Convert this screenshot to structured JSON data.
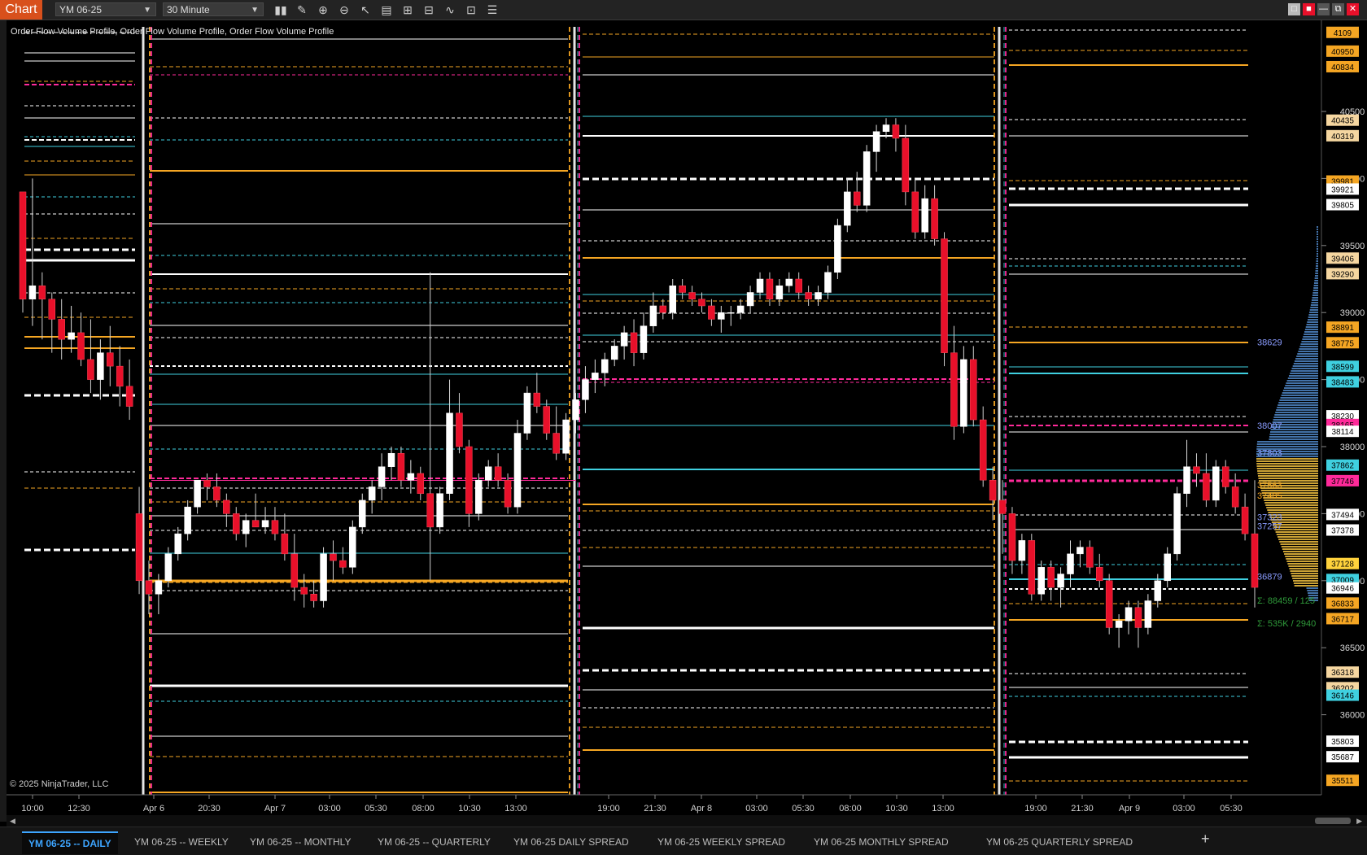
{
  "toolbar": {
    "chart_tab": "Chart",
    "instrument": "YM 06-25",
    "interval": "30 Minute",
    "tools": [
      {
        "icon": "bar-style-icon",
        "glyph": "▮▮"
      },
      {
        "icon": "draw-pencil-icon",
        "glyph": "✎"
      },
      {
        "icon": "zoom-in-icon",
        "glyph": "⊕"
      },
      {
        "icon": "zoom-out-icon",
        "glyph": "⊖"
      },
      {
        "icon": "pointer-icon",
        "glyph": "↖"
      },
      {
        "icon": "properties-icon",
        "glyph": "▤"
      },
      {
        "icon": "templates-icon",
        "glyph": "⊞"
      },
      {
        "icon": "strategies-icon",
        "glyph": "⊟"
      },
      {
        "icon": "indicators-icon",
        "glyph": "∿"
      },
      {
        "icon": "data-box-icon",
        "glyph": "⊡"
      },
      {
        "icon": "list-icon",
        "glyph": "☰"
      }
    ],
    "window_buttons": [
      "□",
      "■",
      "—",
      "⧉",
      "✕"
    ]
  },
  "chart": {
    "indicator_title": "Order Flow Volume Profile, Order Flow Volume Profile, Order Flow Volume Profile",
    "copyright": "© 2025 NinjaTrader, LLC",
    "colors": {
      "background": "#000000",
      "up": "#ffffff",
      "down": "#e8102a",
      "orange": "#f5a623",
      "cyan": "#3fd0e0",
      "magenta": "#ff2a9a"
    }
  },
  "chart_data": {
    "type": "candlestick",
    "instrument": "YM 06-25",
    "interval": "30 Minute",
    "y_ticks": [
      40500,
      40000,
      39500,
      39000,
      38500,
      38000,
      37500,
      37000,
      36500,
      36000
    ],
    "x_ticks": [
      {
        "label": "10:00",
        "x": 40
      },
      {
        "label": "12:30",
        "x": 97
      },
      {
        "label": "Apr 6",
        "x": 189
      },
      {
        "label": "20:30",
        "x": 257
      },
      {
        "label": "Apr 7",
        "x": 338
      },
      {
        "label": "03:00",
        "x": 405
      },
      {
        "label": "05:30",
        "x": 462
      },
      {
        "label": "08:00",
        "x": 520
      },
      {
        "label": "10:30",
        "x": 577
      },
      {
        "label": "13:00",
        "x": 634
      },
      {
        "label": "19:00",
        "x": 748
      },
      {
        "label": "21:30",
        "x": 805
      },
      {
        "label": "Apr 8",
        "x": 862
      },
      {
        "label": "03:00",
        "x": 930
      },
      {
        "label": "05:30",
        "x": 987
      },
      {
        "label": "08:00",
        "x": 1045
      },
      {
        "label": "10:30",
        "x": 1102
      },
      {
        "label": "13:00",
        "x": 1159
      },
      {
        "label": "19:00",
        "x": 1273
      },
      {
        "label": "21:30",
        "x": 1330
      },
      {
        "label": "Apr 9",
        "x": 1388
      },
      {
        "label": "03:00",
        "x": 1455
      },
      {
        "label": "05:30",
        "x": 1513
      }
    ],
    "price_badges": [
      {
        "value": "4109",
        "bg": "#f5a623"
      },
      {
        "value": "40950",
        "bg": "#f5a623"
      },
      {
        "value": "40834",
        "bg": "#f5a623"
      },
      {
        "value": "40435",
        "bg": "#f5d6a0"
      },
      {
        "value": "40319",
        "bg": "#f5d6a0"
      },
      {
        "value": "39981",
        "bg": "#f5a623"
      },
      {
        "value": "39921",
        "bg": "#ffffff"
      },
      {
        "value": "39805",
        "bg": "#ffffff"
      },
      {
        "value": "39406",
        "bg": "#f5d6a0"
      },
      {
        "value": "39290",
        "bg": "#f5d6a0"
      },
      {
        "value": "38891",
        "bg": "#f5a623"
      },
      {
        "value": "38775",
        "bg": "#f5a623"
      },
      {
        "value": "38599",
        "bg": "#3fd0e0"
      },
      {
        "value": "38483",
        "bg": "#3fd0e0"
      },
      {
        "value": "38230",
        "bg": "#ffffff"
      },
      {
        "value": "38165",
        "bg": "#ff2a9a"
      },
      {
        "value": "38114",
        "bg": "#ffffff"
      },
      {
        "value": "37862",
        "bg": "#3fd0e0"
      },
      {
        "value": "37746",
        "bg": "#ff2a9a"
      },
      {
        "value": "37494",
        "bg": "#ffffff"
      },
      {
        "value": "37378",
        "bg": "#ffffff"
      },
      {
        "value": "37128",
        "bg": "#ffd23c"
      },
      {
        "value": "37009",
        "bg": "#3fd0e0"
      },
      {
        "value": "36946",
        "bg": "#ffffff"
      },
      {
        "value": "36833",
        "bg": "#f5a623"
      },
      {
        "value": "36717",
        "bg": "#f5a623"
      },
      {
        "value": "36318",
        "bg": "#f5d6a0"
      },
      {
        "value": "36202",
        "bg": "#f5d6a0"
      },
      {
        "value": "36146",
        "bg": "#3fd0e0"
      },
      {
        "value": "35803",
        "bg": "#ffffff"
      },
      {
        "value": "35687",
        "bg": "#ffffff"
      },
      {
        "value": "35511",
        "bg": "#f5a623"
      }
    ],
    "profile_labels": [
      {
        "value": "38629",
        "color": "#8a9cff"
      },
      {
        "value": "38007",
        "color": "#8a9cff"
      },
      {
        "value": "37803",
        "color": "#8a9cff"
      },
      {
        "value": "37563",
        "color": "#f5a623"
      },
      {
        "value": "37485",
        "color": "#f5a623"
      },
      {
        "value": "37323",
        "color": "#8a9cff"
      },
      {
        "value": "37257",
        "color": "#8a9cff"
      },
      {
        "value": "36879",
        "color": "#8a9cff"
      },
      {
        "value": "Σ: 88459 / 125",
        "color": "#2f9a3a"
      },
      {
        "value": "Σ: 535K / 2940",
        "color": "#2f9a3a"
      }
    ],
    "candles": [
      [
        39900,
        39800,
        39000,
        39100
      ],
      [
        39100,
        40000,
        38900,
        39200
      ],
      [
        39200,
        39300,
        38800,
        39100
      ],
      [
        39100,
        39150,
        38700,
        38950
      ],
      [
        38950,
        39100,
        38650,
        38800
      ],
      [
        38800,
        39050,
        38700,
        38850
      ],
      [
        38850,
        39000,
        38600,
        38650
      ],
      [
        38650,
        38950,
        38400,
        38500
      ],
      [
        38500,
        38800,
        38350,
        38700
      ],
      [
        38700,
        38900,
        38450,
        38600
      ],
      [
        38600,
        38750,
        38300,
        38450
      ],
      [
        38450,
        38650,
        38200,
        38300
      ],
      [
        37500,
        37700,
        36900,
        37000
      ],
      [
        37000,
        37150,
        36750,
        36900
      ],
      [
        36900,
        37050,
        36750,
        37000
      ],
      [
        37000,
        37250,
        36950,
        37200
      ],
      [
        37200,
        37400,
        37150,
        37350
      ],
      [
        37350,
        37600,
        37300,
        37550
      ],
      [
        37550,
        37750,
        37500,
        37750
      ],
      [
        37750,
        37800,
        37600,
        37700
      ],
      [
        37700,
        37800,
        37550,
        37600
      ],
      [
        37600,
        37650,
        37400,
        37500
      ],
      [
        37500,
        37550,
        37300,
        37350
      ],
      [
        37350,
        37500,
        37250,
        37450
      ],
      [
        37450,
        37650,
        37400,
        37400
      ],
      [
        37400,
        37550,
        37350,
        37450
      ],
      [
        37450,
        37550,
        37300,
        37350
      ],
      [
        37350,
        37500,
        37150,
        37200
      ],
      [
        37200,
        37350,
        36850,
        36950
      ],
      [
        36950,
        37050,
        36800,
        36900
      ],
      [
        36900,
        37000,
        36800,
        36850
      ],
      [
        36850,
        37250,
        36800,
        37200
      ],
      [
        37200,
        37300,
        37000,
        37150
      ],
      [
        37150,
        37250,
        37050,
        37100
      ],
      [
        37100,
        37450,
        37050,
        37400
      ],
      [
        37400,
        37650,
        37350,
        37600
      ],
      [
        37600,
        37750,
        37500,
        37700
      ],
      [
        37700,
        37950,
        37600,
        37850
      ],
      [
        37850,
        38000,
        37750,
        37950
      ],
      [
        37950,
        38000,
        37700,
        37750
      ],
      [
        37750,
        37900,
        37650,
        37800
      ],
      [
        37800,
        37850,
        37600,
        37650
      ],
      [
        37650,
        39300,
        37000,
        37400
      ],
      [
        37400,
        37700,
        37350,
        37650
      ],
      [
        37650,
        38500,
        37600,
        38250
      ],
      [
        38250,
        38400,
        37950,
        38000
      ],
      [
        38000,
        38050,
        37400,
        37500
      ],
      [
        37500,
        37800,
        37450,
        37750
      ],
      [
        37750,
        37900,
        37700,
        37850
      ],
      [
        37850,
        37950,
        37700,
        37750
      ],
      [
        37750,
        37800,
        37500,
        37550
      ],
      [
        37550,
        38200,
        37500,
        38100
      ],
      [
        38100,
        38450,
        38050,
        38400
      ],
      [
        38400,
        38550,
        38250,
        38300
      ],
      [
        38300,
        38350,
        38050,
        38100
      ],
      [
        38100,
        38300,
        37900,
        37950
      ],
      [
        37950,
        38250,
        37900,
        38200
      ],
      [
        38200,
        38400,
        38100,
        38350
      ],
      [
        38350,
        38600,
        38250,
        38500
      ],
      [
        38500,
        38650,
        38400,
        38550
      ],
      [
        38550,
        38700,
        38450,
        38650
      ],
      [
        38650,
        38800,
        38600,
        38750
      ],
      [
        38750,
        38900,
        38650,
        38850
      ],
      [
        38850,
        38950,
        38600,
        38700
      ],
      [
        38700,
        39000,
        38650,
        38900
      ],
      [
        38900,
        39150,
        38850,
        39050
      ],
      [
        39050,
        39100,
        38950,
        39000
      ],
      [
        39000,
        39250,
        38950,
        39200
      ],
      [
        39200,
        39250,
        39100,
        39150
      ],
      [
        39150,
        39200,
        39050,
        39100
      ],
      [
        39100,
        39150,
        39000,
        39050
      ],
      [
        39050,
        39100,
        38900,
        38950
      ],
      [
        38950,
        39050,
        38850,
        39000
      ],
      [
        39000,
        39050,
        38900,
        39000
      ],
      [
        39000,
        39100,
        38950,
        39050
      ],
      [
        39050,
        39200,
        39000,
        39150
      ],
      [
        39150,
        39300,
        39100,
        39250
      ],
      [
        39250,
        39300,
        39050,
        39100
      ],
      [
        39100,
        39250,
        39050,
        39200
      ],
      [
        39200,
        39300,
        39150,
        39250
      ],
      [
        39250,
        39300,
        39100,
        39150
      ],
      [
        39150,
        39200,
        39050,
        39100
      ],
      [
        39100,
        39200,
        39050,
        39150
      ],
      [
        39150,
        39350,
        39100,
        39300
      ],
      [
        39300,
        39700,
        39250,
        39650
      ],
      [
        39650,
        40000,
        39600,
        39900
      ],
      [
        39900,
        40050,
        39750,
        39800
      ],
      [
        39800,
        40250,
        39750,
        40200
      ],
      [
        40200,
        40400,
        40050,
        40350
      ],
      [
        40350,
        40450,
        40300,
        40400
      ],
      [
        40400,
        40450,
        40200,
        40300
      ],
      [
        40300,
        40400,
        39800,
        39900
      ],
      [
        39900,
        40000,
        39550,
        39600
      ],
      [
        39600,
        39950,
        39550,
        39850
      ],
      [
        39850,
        39950,
        39500,
        39550
      ],
      [
        39550,
        39600,
        38600,
        38700
      ],
      [
        38700,
        38900,
        38050,
        38150
      ],
      [
        38150,
        38750,
        38100,
        38650
      ],
      [
        38650,
        38750,
        38150,
        38200
      ],
      [
        38200,
        38300,
        37700,
        37750
      ],
      [
        37750,
        37850,
        37450,
        37600
      ],
      [
        37600,
        37750,
        37200,
        37500
      ],
      [
        37500,
        37550,
        37050,
        37150
      ],
      [
        37150,
        37350,
        37050,
        37300
      ],
      [
        37300,
        37350,
        36850,
        36900
      ],
      [
        36900,
        37150,
        36850,
        37100
      ],
      [
        37100,
        37150,
        36850,
        36950
      ],
      [
        36950,
        37100,
        36800,
        37050
      ],
      [
        37050,
        37300,
        36950,
        37200
      ],
      [
        37200,
        37300,
        37100,
        37250
      ],
      [
        37250,
        37300,
        37050,
        37100
      ],
      [
        37100,
        37200,
        36950,
        37000
      ],
      [
        37000,
        37050,
        36600,
        36650
      ],
      [
        36650,
        36750,
        36500,
        36700
      ],
      [
        36700,
        36850,
        36600,
        36800
      ],
      [
        36800,
        36850,
        36500,
        36650
      ],
      [
        36650,
        36900,
        36600,
        36850
      ],
      [
        36850,
        37050,
        36800,
        37000
      ],
      [
        37000,
        37250,
        36950,
        37200
      ],
      [
        37200,
        37700,
        37150,
        37650
      ],
      [
        37650,
        38050,
        37550,
        37850
      ],
      [
        37850,
        37950,
        37700,
        37800
      ],
      [
        37800,
        37950,
        37550,
        37600
      ],
      [
        37600,
        37900,
        37550,
        37850
      ],
      [
        37850,
        37900,
        37650,
        37700
      ],
      [
        37700,
        37800,
        37500,
        37550
      ],
      [
        37550,
        37650,
        37300,
        37350
      ],
      [
        37350,
        37750,
        36800,
        36950
      ]
    ]
  },
  "bottom_tabs": [
    "YM 06-25 -- DAILY",
    "YM 06-25 -- WEEKLY",
    "YM 06-25 -- MONTHLY",
    "YM 06-25 -- QUARTERLY",
    "YM 06-25 DAILY SPREAD",
    "YM 06-25 WEEKLY SPREAD",
    "YM 06-25 MONTHLY SPREAD",
    "YM 06-25 QUARTERLY SPREAD"
  ],
  "add_tab": "+"
}
